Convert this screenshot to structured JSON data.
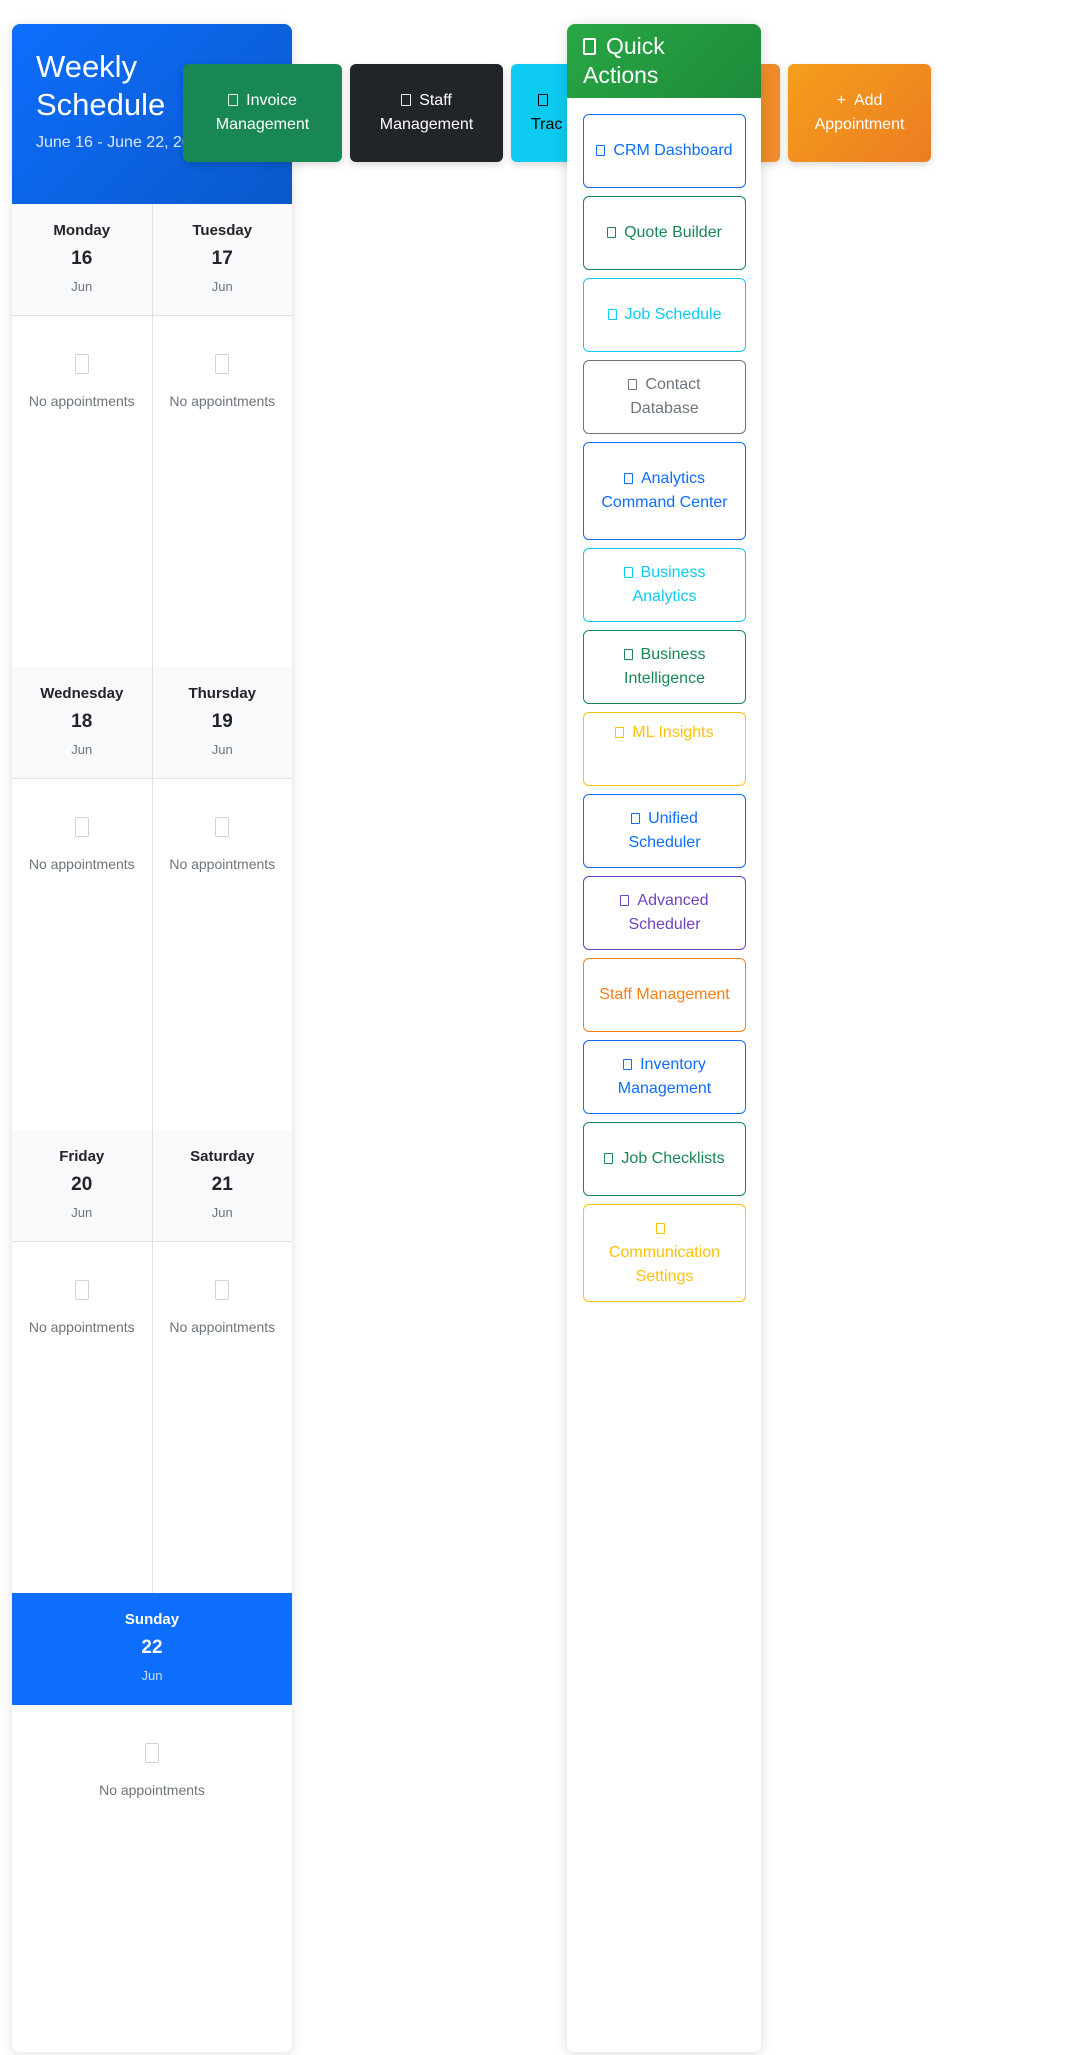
{
  "schedule": {
    "title": "Weekly Schedule",
    "range": "June 16 - June 22, 2025",
    "empty_text": "No appointments",
    "days": [
      {
        "name": "Monday",
        "num": "16",
        "month": "Jun"
      },
      {
        "name": "Tuesday",
        "num": "17",
        "month": "Jun"
      },
      {
        "name": "Wednesday",
        "num": "18",
        "month": "Jun"
      },
      {
        "name": "Thursday",
        "num": "19",
        "month": "Jun"
      },
      {
        "name": "Friday",
        "num": "20",
        "month": "Jun"
      },
      {
        "name": "Saturday",
        "num": "21",
        "month": "Jun"
      },
      {
        "name": "Sunday",
        "num": "22",
        "month": "Jun"
      }
    ]
  },
  "top_buttons": {
    "invoice": "Invoice Management",
    "staff": "Staff Management",
    "tracking": "Trac",
    "add_icon": "+",
    "add": "Add Appointment"
  },
  "quick_actions": {
    "title": "Quick Actions",
    "items": [
      {
        "label": "CRM Dashboard",
        "color": "#0d6efd"
      },
      {
        "label": "Quote Builder",
        "color": "#198754"
      },
      {
        "label": "Job Schedule",
        "color": "#0dcaf0"
      },
      {
        "label": "Contact Database",
        "color": "#6c757d"
      },
      {
        "label": "Analytics Command Center",
        "color": "#0d6efd"
      },
      {
        "label": "Business Analytics",
        "color": "#0dcaf0"
      },
      {
        "label": "Business Intelligence",
        "color": "#198754"
      },
      {
        "label": "ML Insights",
        "color": "#ffc107"
      },
      {
        "label": "Unified Scheduler",
        "color": "#0d6efd"
      },
      {
        "label": "Advanced Scheduler",
        "color": "#6f42c1"
      },
      {
        "label": "Staff Management",
        "color": "#fd7e14"
      },
      {
        "label": "Inventory Management",
        "color": "#0d6efd"
      },
      {
        "label": "Job Checklists",
        "color": "#198754"
      },
      {
        "label": "Communication Settings",
        "color": "#ffc107"
      }
    ]
  }
}
